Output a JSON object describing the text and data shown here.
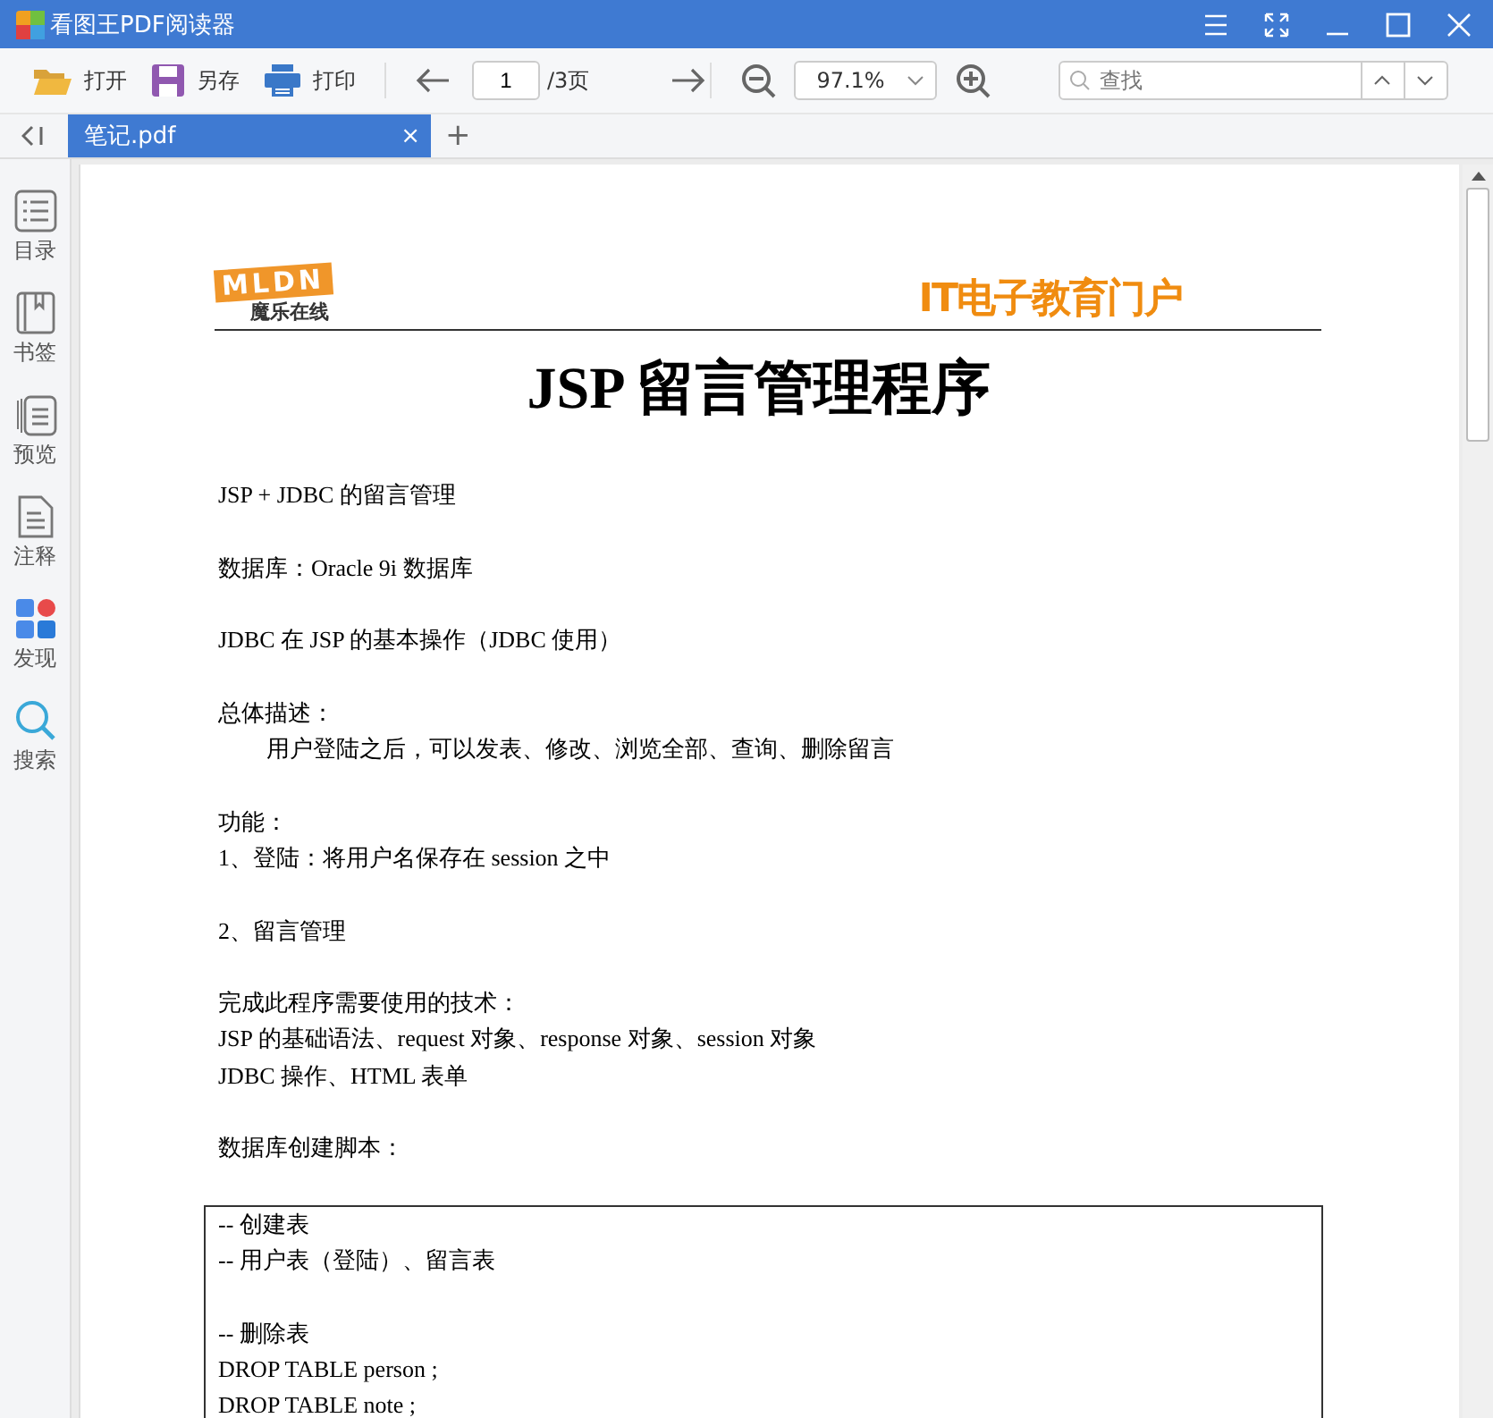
{
  "window": {
    "title": "看图王PDF阅读器"
  },
  "toolbar": {
    "open": "打开",
    "save_as": "另存",
    "print": "打印",
    "page": "1",
    "page_total": "/3页",
    "zoom": "97.1%",
    "search": {
      "placeholder": "查找"
    }
  },
  "tabs": [
    {
      "label": "笔记.pdf",
      "selected": true,
      "close": "×"
    }
  ],
  "new_tab": "+",
  "sidebar": {
    "items": [
      {
        "kind": "toc",
        "label": "目录"
      },
      {
        "kind": "bookmark",
        "label": "书签"
      },
      {
        "kind": "preview",
        "label": "预览"
      },
      {
        "kind": "note",
        "label": "注释"
      },
      {
        "kind": "discover",
        "label": "发现"
      },
      {
        "kind": "search",
        "label": "搜索"
      }
    ]
  },
  "document": {
    "header_left": {
      "logo": "MLDN",
      "tagline": "魔乐在线"
    },
    "header_right": "IT电子教育门户",
    "title": "JSP 留言管理程序",
    "paragraphs": [
      {
        "lines": [
          {
            "text": "JSP + JDBC 的留言管理",
            "kind": "plain"
          }
        ]
      },
      {
        "lines": [
          {
            "text": "数据库：Oracle 9i 数据库",
            "kind": "plain"
          }
        ]
      },
      {
        "lines": [
          {
            "text": "JDBC 在 JSP 的基本操作（JDBC 使用）",
            "kind": "plain"
          }
        ]
      },
      {
        "lines": [
          {
            "text": "总体描述：",
            "kind": "plain"
          },
          {
            "text": "用户登陆之后，可以发表、修改、浏览全部、查询、删除留言",
            "kind": "indented"
          }
        ]
      },
      {
        "lines": [
          {
            "text": "功能：",
            "kind": "plain"
          },
          {
            "text": "1、登陆：将用户名保存在 session 之中",
            "kind": "plain"
          }
        ]
      },
      {
        "lines": [
          {
            "text": "2、留言管理",
            "kind": "plain"
          }
        ]
      },
      {
        "lines": [
          {
            "text": "完成此程序需要使用的技术：",
            "kind": "plain"
          },
          {
            "text": "JSP 的基础语法、request 对象、response 对象、session 对象",
            "kind": "plain"
          },
          {
            "text": "JDBC 操作、HTML 表单",
            "kind": "plain"
          }
        ]
      },
      {
        "lines": [
          {
            "text": "数据库创建脚本：",
            "kind": "plain"
          }
        ]
      }
    ],
    "code_box": {
      "paragraphs": [
        {
          "lines": [
            "--  创建表",
            "--  用户表（登陆）、留言表"
          ]
        },
        {
          "lines": [
            "--  删除表",
            "DROP TABLE person ;",
            "DROP TABLE note ;"
          ]
        }
      ]
    }
  }
}
